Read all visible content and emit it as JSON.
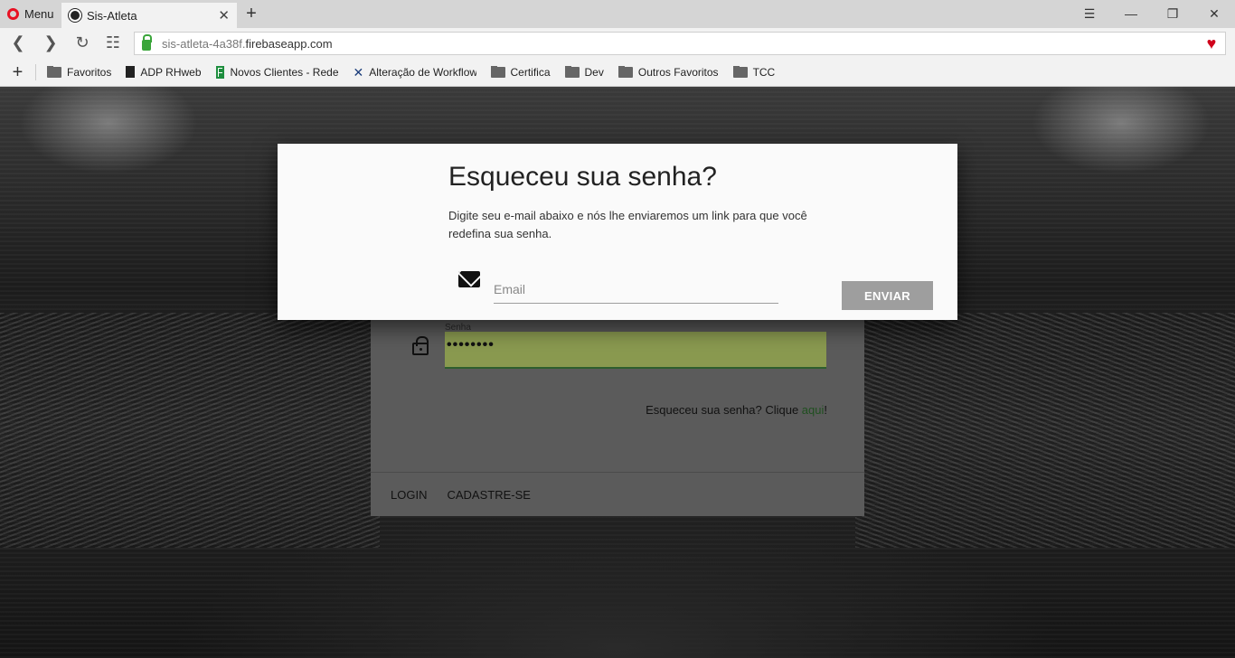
{
  "browser": {
    "menu_label": "Menu",
    "tab_title": "Sis-Atleta",
    "url_prefix": "sis-atleta-4a38f.",
    "url_domain": "firebaseapp.com",
    "bookmarks": [
      {
        "label": "Favoritos",
        "icon": "folder-icon"
      },
      {
        "label": "ADP RHweb",
        "icon": "document-icon"
      },
      {
        "label": "Novos Clientes - Rede",
        "icon": "spreadsheet-icon"
      },
      {
        "label": "Alteração de Workflow",
        "icon": "x-app-icon"
      },
      {
        "label": "Certifica",
        "icon": "folder-icon"
      },
      {
        "label": "Dev",
        "icon": "folder-icon"
      },
      {
        "label": "Outros Favoritos",
        "icon": "folder-icon"
      },
      {
        "label": "TCC",
        "icon": "folder-icon"
      }
    ]
  },
  "login": {
    "password_label": "Senha",
    "password_value": "••••••••",
    "forgot_text": "Esqueceu sua senha? Clique ",
    "forgot_link": "aqui",
    "forgot_suffix": "!",
    "login_button": "LOGIN",
    "register_button": "CADASTRE-SE"
  },
  "dialog": {
    "title": "Esqueceu sua senha?",
    "description": "Digite seu e-mail abaixo e nós lhe enviaremos um link para que você redefina sua senha.",
    "email_placeholder": "Email",
    "send_button": "ENVIAR"
  },
  "colors": {
    "accent_green": "#3aa53a",
    "heart_red": "#d0021b",
    "button_gray": "#9e9e9e"
  }
}
